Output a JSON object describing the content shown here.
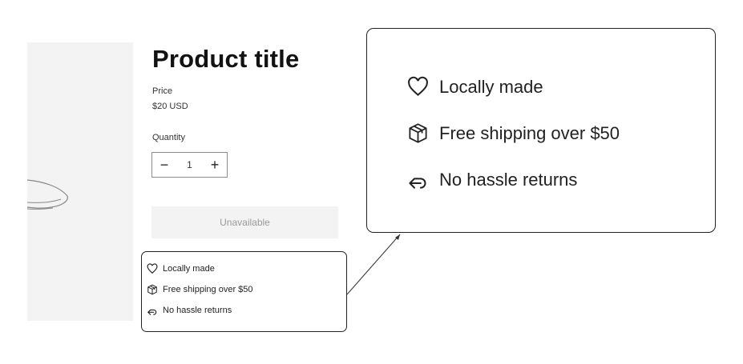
{
  "product": {
    "title": "Product title",
    "price_label": "Price",
    "price_value": "$20 USD",
    "quantity_label": "Quantity",
    "quantity_value": "1",
    "decrement_symbol": "−",
    "increment_symbol": "+",
    "buy_button_label": "Unavailable"
  },
  "features": [
    {
      "icon": "heart-icon",
      "label": "Locally made"
    },
    {
      "icon": "box-icon",
      "label": "Free shipping over $50"
    },
    {
      "icon": "return-arrow-icon",
      "label": "No hassle returns"
    }
  ],
  "colors": {
    "media_bg": "#f3f3f3",
    "button_disabled_bg": "#f3f3f3",
    "button_disabled_text": "#9a9a9a",
    "text": "#121212"
  }
}
